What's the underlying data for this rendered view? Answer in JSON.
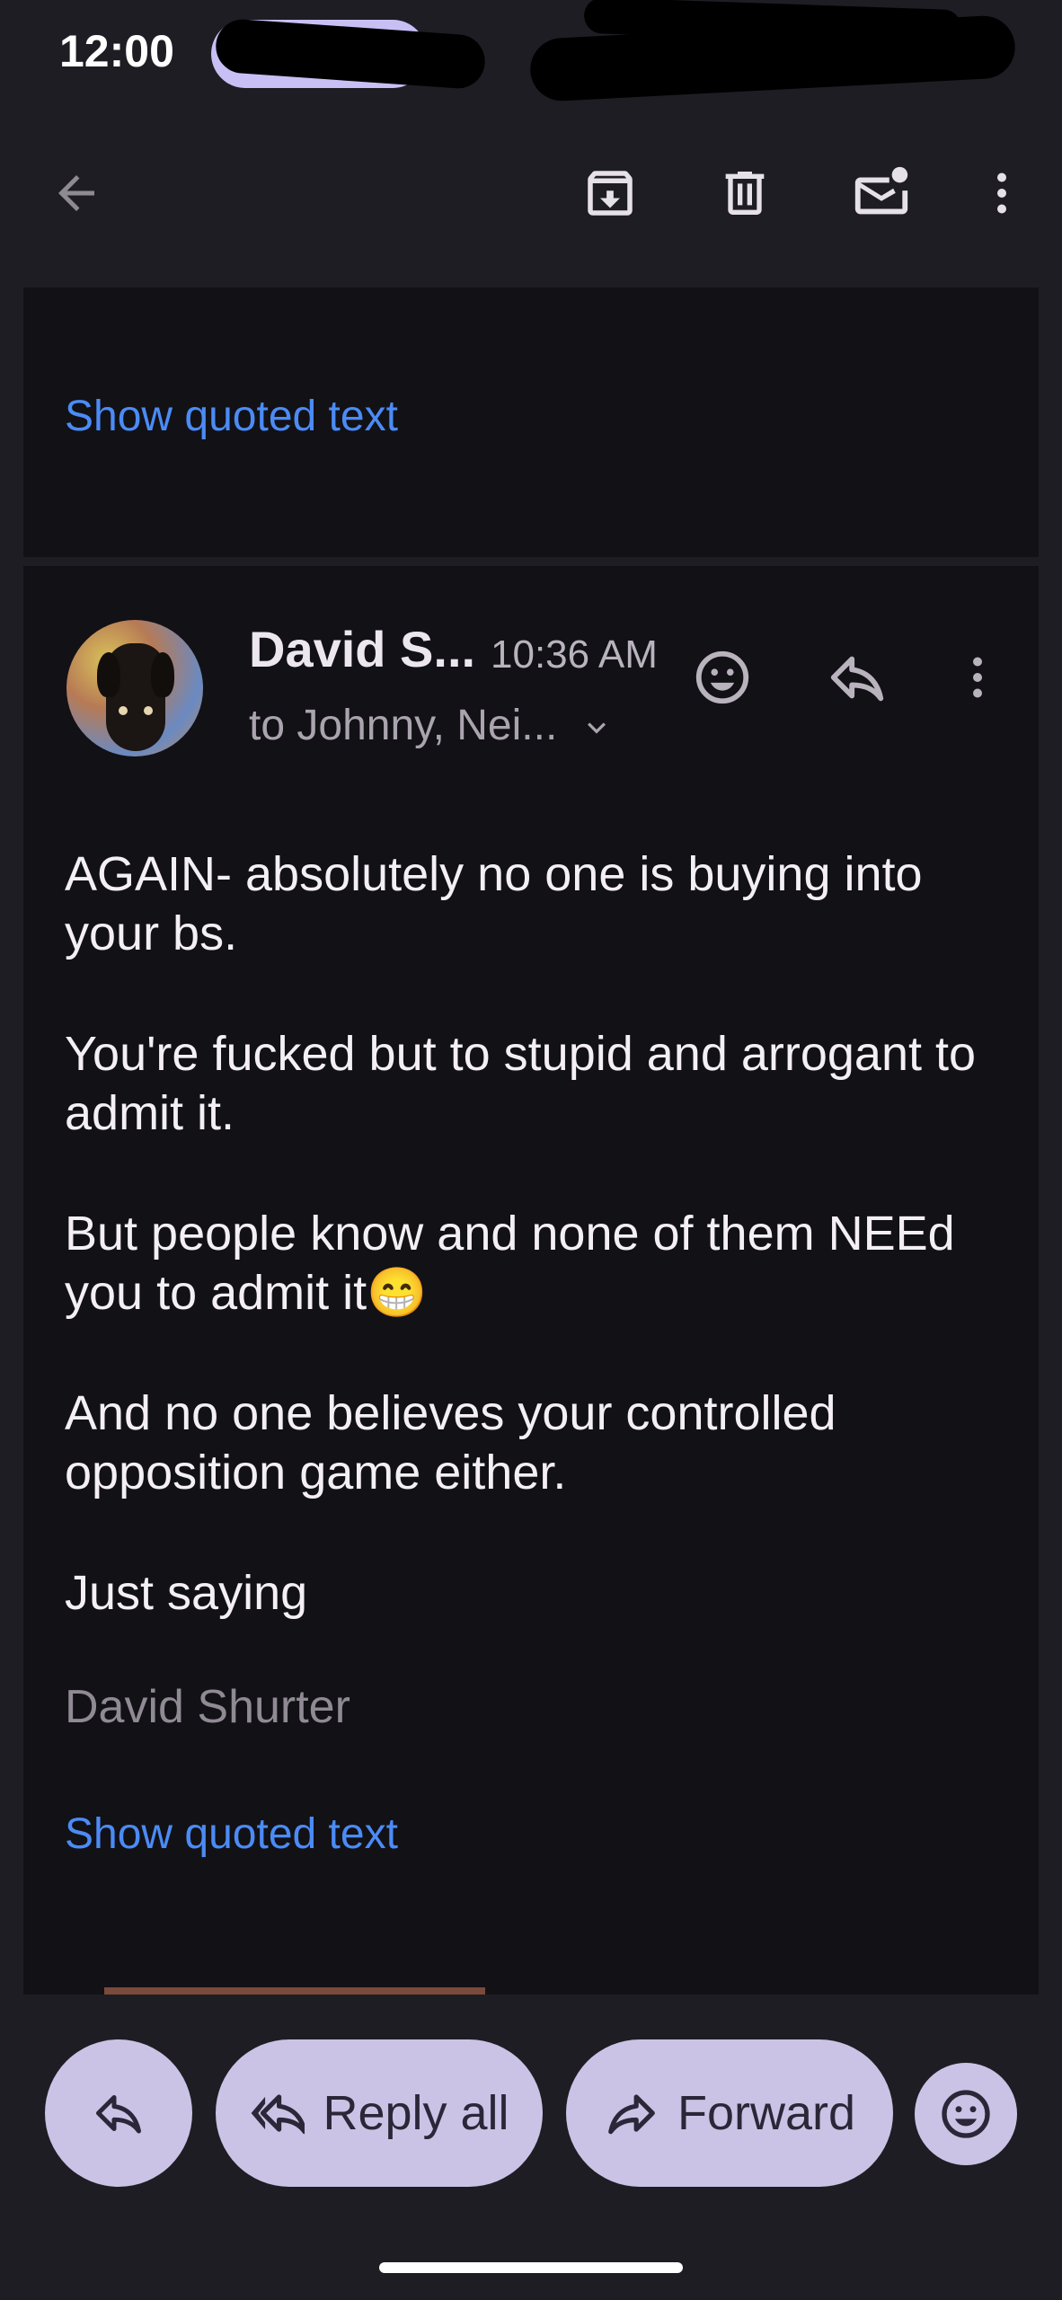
{
  "status_bar": {
    "time": "12:00"
  },
  "toolbar": {
    "back_icon": "arrow-back-icon",
    "archive_icon": "archive-icon",
    "delete_icon": "trash-icon",
    "mark_unread_icon": "mail-unread-icon",
    "more_icon": "more-vertical-icon"
  },
  "previous_message": {
    "show_quoted_text": "Show quoted text"
  },
  "message": {
    "sender": "David S...",
    "time": "10:36 AM",
    "recipients": "to Johnny, Nei...",
    "body": [
      "AGAIN- absolutely no one is buying into your bs.",
      "You're fucked but to stupid and arrogant to admit it.",
      "But people know and none of them NEEd you to admit it😁",
      "And no one believes your controlled opposition game either.",
      "Just saying"
    ],
    "signature": "David Shurter",
    "show_quoted_text": "Show quoted text"
  },
  "actions": {
    "reply_all": "Reply all",
    "forward": "Forward"
  },
  "colors": {
    "background": "#1e1d23",
    "card": "#121116",
    "link": "#4b8bf5",
    "button": "#cbc3e6"
  }
}
